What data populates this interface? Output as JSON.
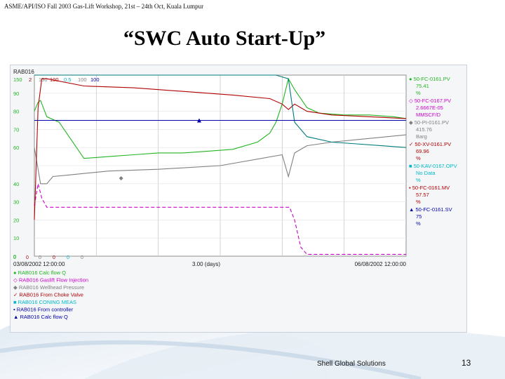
{
  "header": {
    "workshop": "ASME/API/ISO Fall 2003 Gas-Lift Workshop, 21st – 24th Oct, Kuala Lumpur"
  },
  "slide": {
    "title": "“SWC Auto Start-Up”",
    "company": "Shell Global Solutions",
    "page_number": "13"
  },
  "colors": {
    "green": "#22b522",
    "red": "#b00000",
    "gray": "#808080",
    "teal": "#007a7a",
    "magenta": "#cc00cc",
    "blue": "#0000aa",
    "cyan": "#00b8c8"
  },
  "chart_data": {
    "type": "line",
    "title": "RAB016",
    "top_scale_labels": [
      "150",
      "2",
      "150",
      "100",
      "0.5",
      "100",
      "100"
    ],
    "y_tick_labels": [
      "90",
      "80",
      "70",
      "60",
      "40",
      "30",
      "20",
      "10",
      "0"
    ],
    "bottom_scale_labels": [
      "0",
      "0",
      "0",
      "0",
      "0",
      "0"
    ],
    "x_tick_labels": [
      "03/08/2002 12:00:00",
      "3.00 (days)",
      "06/08/2002 12:00:00"
    ],
    "x_range_days": [
      0,
      3
    ],
    "y_range": [
      0,
      100
    ],
    "grid": true,
    "legend_position": "bottom",
    "legend_entries": [
      "RAB016 Calc flow Q",
      "RAB016 Gaslift Flow Injection",
      "RAB016 Wellhead Pressure",
      "RAB016 From Choke Valve",
      "RAB016 CONING MEAS",
      "RAB016 From controller",
      "RAB016 Calc flow Q"
    ],
    "readout": [
      {
        "tag": "50-FC-0161.PV",
        "value": "75.41",
        "unit": "%"
      },
      {
        "tag": "50-FC-0167.PV",
        "value": "2.6667E-05",
        "unit": "MMSCF/D"
      },
      {
        "tag": "50-PI-0161.PV",
        "value": "415.76",
        "unit": "Barg"
      },
      {
        "tag": "50-XV-0161.PV",
        "value": "69.96",
        "unit": "%"
      },
      {
        "tag": "50-KAV-0167.OPV",
        "value": "No Data",
        "unit": "%"
      },
      {
        "tag": "50-FC-0161.MV",
        "value": "57.57",
        "unit": "%"
      },
      {
        "tag": "50-FC-0161.SV",
        "value": "75",
        "unit": "%"
      }
    ],
    "series": [
      {
        "name": "RAB016 Calc flow Q",
        "color": "#22b522",
        "style": "solid",
        "x": [
          0,
          0.03,
          0.05,
          0.1,
          0.2,
          0.4,
          0.6,
          0.8,
          1.0,
          1.2,
          1.4,
          1.6,
          1.8,
          1.9,
          1.95,
          2.0,
          2.05,
          2.1,
          2.2,
          2.3,
          2.5,
          2.7,
          2.9,
          3.0
        ],
        "y": [
          80,
          85,
          86,
          77,
          74,
          54,
          55,
          56,
          57,
          57,
          58,
          59,
          63,
          68,
          74,
          84,
          98,
          92,
          82,
          79,
          78,
          78,
          77,
          76
        ]
      },
      {
        "name": "RAB016 Gaslift Flow Injection",
        "color": "#cc00cc",
        "style": "dashed",
        "x": [
          0,
          0.03,
          0.06,
          0.1,
          0.5,
          1.0,
          1.5,
          2.0,
          2.06,
          2.1,
          2.15,
          2.2,
          2.3,
          2.6,
          3.0
        ],
        "y": [
          28,
          40,
          32,
          27,
          27,
          27,
          27,
          27,
          27,
          20,
          5,
          1,
          1,
          1,
          1
        ]
      },
      {
        "name": "RAB016 Wellhead Pressure",
        "color": "#808080",
        "style": "solid",
        "x": [
          0,
          0.05,
          0.1,
          0.15,
          0.3,
          0.6,
          1.0,
          1.5,
          2.0,
          2.05,
          2.1,
          2.2,
          2.4,
          2.7,
          3.0
        ],
        "y": [
          60,
          40,
          40,
          44,
          45,
          47,
          48,
          50,
          56,
          44,
          57,
          61,
          63,
          65,
          67
        ]
      },
      {
        "name": "RAB016 From Choke Valve",
        "color": "#b00000",
        "style": "solid",
        "x": [
          0,
          0.03,
          0.06,
          0.1,
          0.4,
          0.8,
          1.2,
          1.6,
          1.9,
          2.0,
          2.05,
          2.1,
          2.2,
          2.4,
          2.7,
          3.0
        ],
        "y": [
          20,
          82,
          98,
          98,
          94,
          93,
          91,
          89,
          87,
          84,
          81,
          84,
          80,
          78,
          77,
          76
        ]
      },
      {
        "name": "RAB016 CONING MEAS",
        "color": "#007a7a",
        "style": "solid",
        "x": [
          0,
          0.05,
          0.5,
          1.0,
          1.5,
          1.95,
          2.0,
          2.05,
          2.1,
          2.2,
          2.4,
          2.6,
          2.8,
          3.0
        ],
        "y": [
          100,
          100,
          100,
          100,
          100,
          100,
          99,
          98,
          74,
          66,
          63,
          62,
          61,
          60
        ]
      },
      {
        "name": "RAB016 From controller",
        "color": "#0000aa",
        "style": "solid",
        "x": [
          0,
          0.05,
          1.0,
          2.0,
          3.0
        ],
        "y": [
          75,
          75,
          75,
          75,
          75
        ]
      }
    ]
  }
}
